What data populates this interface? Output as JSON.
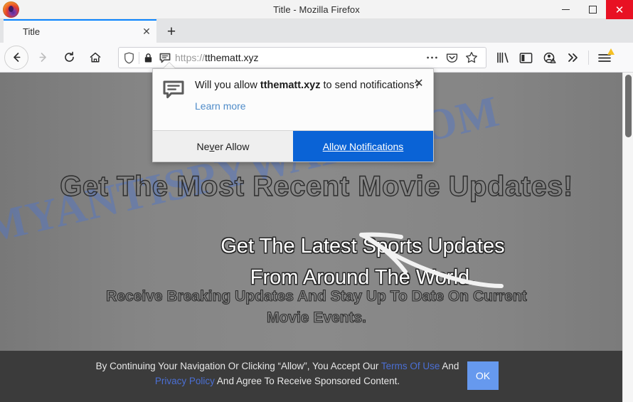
{
  "window": {
    "title": "Title - Mozilla Firefox",
    "logo_icon": "firefox-logo",
    "minimize_label": "Minimize",
    "maximize_label": "Maximize",
    "close_label": "✕"
  },
  "tabs": {
    "items": [
      {
        "label": "Title",
        "close_label": "✕"
      }
    ],
    "new_tab_label": "+"
  },
  "nav": {
    "back_icon": "back-arrow-icon",
    "forward_icon": "forward-arrow-icon",
    "reload_icon": "reload-icon",
    "home_icon": "home-icon"
  },
  "urlbar": {
    "shield_icon": "tracking-protection-shield-icon",
    "lock_icon": "padlock-icon",
    "notification_icon": "notification-permission-icon",
    "scheme": "https://",
    "host": "tthematt.xyz",
    "page_actions_icon": "ellipsis-icon",
    "pocket_icon": "pocket-icon",
    "bookmark_icon": "star-icon"
  },
  "toolbar": {
    "library_icon": "library-icon",
    "sidebar_icon": "sidebar-icon",
    "account_icon": "account-warning-icon",
    "overflow_icon": "chevron-double-right-icon",
    "menu_icon": "hamburger-menu-icon",
    "menu_badge": "update-warning-badge"
  },
  "popup": {
    "icon": "notification-bubble-icon",
    "question_prefix": "Will you allow ",
    "question_host": "tthematt.xyz",
    "question_suffix": " to send notifications?",
    "learn_more": "Learn more",
    "close_label": "✕",
    "never_allow_pre": "Ne",
    "never_allow_key": "v",
    "never_allow_post": "er Allow",
    "allow_label": "Allow Notifications",
    "allow_color": "#0a63d6"
  },
  "page": {
    "watermark": "MYANTISPYWARE.COM",
    "headline_1": "Get The Most Recent Movie Updates!",
    "headline_2_line_1": "Get The Latest Sports Updates",
    "headline_2_line_2": "From Around The World.",
    "headline_3_line_1": "Receive Breaking Updates And Stay Up To Date On Current",
    "headline_3_line_2": "Movie Events.",
    "arrow_icon": "curved-arrow-pointing-to-allow-button",
    "background_color": "#878787"
  },
  "footer": {
    "text_1": "By Continuing Your Navigation Or Clicking “Allow”, You Accept Our ",
    "link_terms": "Terms Of Use",
    "text_2": " And ",
    "link_privacy": "Privacy Policy",
    "text_3": " And Agree To Receive Sponsored Content.",
    "ok_label": "OK",
    "ok_color": "#6699ee",
    "background_color": "#3b3b3b"
  },
  "scrollbar": {
    "thumb_label": "vertical-scroll-thumb"
  }
}
